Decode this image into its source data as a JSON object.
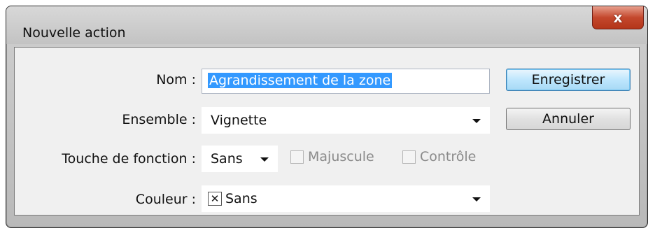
{
  "window": {
    "title": "Nouvelle action",
    "close_glyph": "x"
  },
  "form": {
    "nom": {
      "label": "Nom :",
      "value": "Agrandissement de la zone"
    },
    "ensemble": {
      "label": "Ensemble :",
      "value": "Vignette"
    },
    "touche": {
      "label": "Touche de fonction :",
      "value": "Sans"
    },
    "majuscule": {
      "label": "Majuscule",
      "checked": false
    },
    "controle": {
      "label": "Contrôle",
      "checked": false
    },
    "couleur": {
      "label": "Couleur :",
      "value": "Sans",
      "swatch_glyph": "✕"
    }
  },
  "buttons": {
    "save": "Enregistrer",
    "cancel": "Annuler"
  },
  "icons": {
    "close": "close-icon",
    "dropdown": "chevron-down-icon",
    "color_none": "no-color-icon"
  },
  "colors": {
    "selection": "#3399ff",
    "close_button": "#c4482d",
    "default_button_border": "#3c7fb1"
  }
}
